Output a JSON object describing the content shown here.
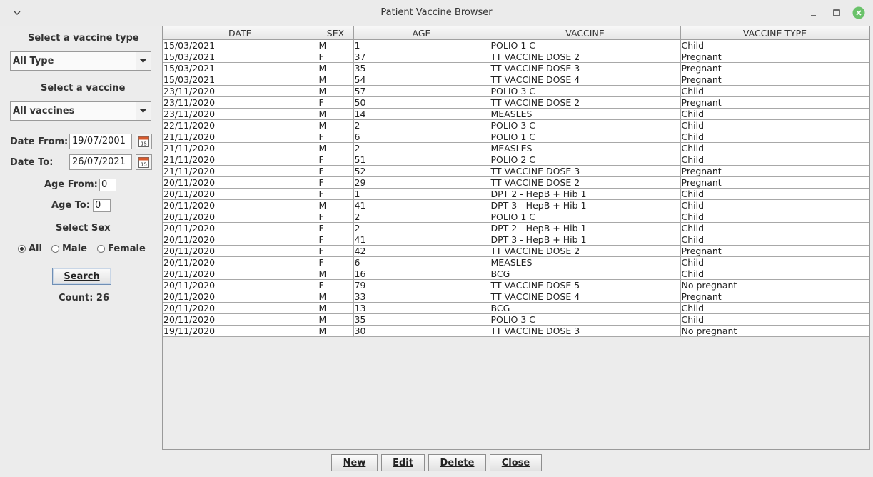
{
  "window": {
    "title": "Patient Vaccine Browser"
  },
  "filters": {
    "vaccine_type_label": "Select a vaccine type",
    "vaccine_type_value": "All Type",
    "vaccine_label": "Select a vaccine",
    "vaccine_value": "All vaccines",
    "date_from_label": "Date From:",
    "date_from_value": "19/07/2001",
    "date_to_label": "Date To:",
    "date_to_value": "26/07/2021",
    "age_from_label": "Age From:",
    "age_from_value": "0",
    "age_to_label": "Age To:",
    "age_to_value": "0",
    "sex_label": "Select Sex",
    "sex_options": [
      "All",
      "Male",
      "Female"
    ],
    "sex_selected": "All",
    "search_label": "Search",
    "count_text": "Count: 26"
  },
  "table": {
    "columns": [
      "DATE",
      "SEX",
      "AGE",
      "VACCINE",
      "VACCINE TYPE"
    ],
    "rows": [
      [
        "15/03/2021",
        "M",
        "1",
        "POLIO 1 C",
        "Child"
      ],
      [
        "15/03/2021",
        "F",
        "37",
        "TT VACCINE DOSE 2",
        "Pregnant"
      ],
      [
        "15/03/2021",
        "M",
        "35",
        "TT VACCINE DOSE 3",
        "Pregnant"
      ],
      [
        "15/03/2021",
        "M",
        "54",
        "TT VACCINE DOSE 4",
        "Pregnant"
      ],
      [
        "23/11/2020",
        "M",
        "57",
        "POLIO 3 C",
        "Child"
      ],
      [
        "23/11/2020",
        "F",
        "50",
        "TT VACCINE DOSE 2",
        "Pregnant"
      ],
      [
        "23/11/2020",
        "M",
        "14",
        "MEASLES",
        "Child"
      ],
      [
        "22/11/2020",
        "M",
        "2",
        "POLIO 3 C",
        "Child"
      ],
      [
        "21/11/2020",
        "F",
        "6",
        "POLIO 1 C",
        "Child"
      ],
      [
        "21/11/2020",
        "M",
        "2",
        "MEASLES",
        "Child"
      ],
      [
        "21/11/2020",
        "F",
        "51",
        "POLIO 2 C",
        "Child"
      ],
      [
        "21/11/2020",
        "F",
        "52",
        "TT VACCINE DOSE 3",
        "Pregnant"
      ],
      [
        "20/11/2020",
        "F",
        "29",
        "TT VACCINE DOSE 2",
        "Pregnant"
      ],
      [
        "20/11/2020",
        "F",
        "1",
        "DPT 2 - HepB + Hib 1",
        "Child"
      ],
      [
        "20/11/2020",
        "M",
        "41",
        "DPT 3 - HepB + Hib 1",
        "Child"
      ],
      [
        "20/11/2020",
        "F",
        "2",
        "POLIO 1 C",
        "Child"
      ],
      [
        "20/11/2020",
        "F",
        "2",
        "DPT 2 - HepB + Hib 1",
        "Child"
      ],
      [
        "20/11/2020",
        "F",
        "41",
        "DPT 3 - HepB + Hib 1",
        "Child"
      ],
      [
        "20/11/2020",
        "F",
        "42",
        "TT VACCINE DOSE 2",
        "Pregnant"
      ],
      [
        "20/11/2020",
        "F",
        "6",
        "MEASLES",
        "Child"
      ],
      [
        "20/11/2020",
        "M",
        "16",
        "BCG",
        "Child"
      ],
      [
        "20/11/2020",
        "F",
        "79",
        "TT VACCINE DOSE 5",
        "No pregnant"
      ],
      [
        "20/11/2020",
        "M",
        "33",
        "TT VACCINE DOSE 4",
        "Pregnant"
      ],
      [
        "20/11/2020",
        "M",
        "13",
        "BCG",
        "Child"
      ],
      [
        "20/11/2020",
        "M",
        "35",
        "POLIO 3 C",
        "Child"
      ],
      [
        "19/11/2020",
        "M",
        "30",
        "TT VACCINE DOSE 3",
        "No pregnant"
      ]
    ]
  },
  "actions": {
    "new": "New",
    "edit": "Edit",
    "delete": "Delete",
    "close": "Close"
  },
  "icons": {
    "window_menu": "chevron-down-icon",
    "minimize": "minimize-icon",
    "maximize": "maximize-icon",
    "close": "close-icon",
    "calendar": "calendar-icon"
  },
  "colors": {
    "close_button": "#6ac26a",
    "grid_line": "#a8a8a8"
  }
}
